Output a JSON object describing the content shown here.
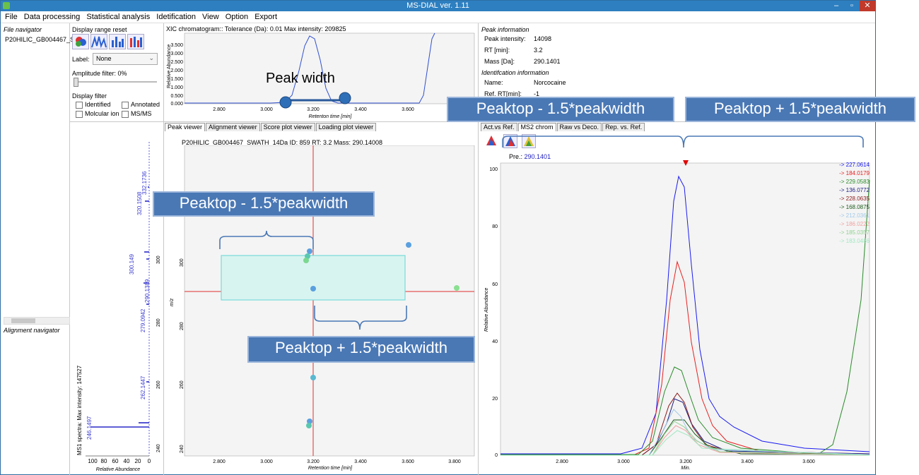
{
  "window": {
    "title": "MS-DIAL ver. 1.11"
  },
  "menu": [
    "File",
    "Data processing",
    "Statistical analysis",
    "Idetification",
    "View",
    "Option",
    "Export"
  ],
  "file_navigator": {
    "title": "File navigator",
    "file": "P20HILIC_GB004467_S",
    "alignment_title": "Alignment navigator"
  },
  "display": {
    "range_reset": "Display range reset",
    "label_caption": "Label:",
    "label_value": "None",
    "amplitude": "Amplitude filter: 0%",
    "filter_title": "Display filter",
    "filters": [
      "Identified",
      "Annotated",
      "Molcular ion",
      "MS/MS"
    ]
  },
  "xic": {
    "title": "XIC chromatogram:: Tolerance (Da): 0.01  Max intensity: 209825",
    "yticks": [
      "3.500",
      "3.000",
      "2.500",
      "2.000",
      "1.500",
      "1.000",
      "0.500",
      "0.000"
    ],
    "ylabel": "Relative Abundance",
    "xticks": [
      "2.800",
      "3.000",
      "3.200",
      "3.400",
      "3.600"
    ],
    "xlabel": "Retenton time [min]"
  },
  "peak_info": {
    "title": "Peak information",
    "rows": [
      {
        "k": "Peak intensity:",
        "v": "14098"
      },
      {
        "k": "RT [min]:",
        "v": "3.2"
      },
      {
        "k": "Mass [Da]:",
        "v": "290.1401"
      }
    ],
    "ident_title": "Identifcation information",
    "ident_rows": [
      {
        "k": "Name:",
        "v": "Norcocaine"
      },
      {
        "k": "Ref. RT[min]:",
        "v": "-1"
      }
    ]
  },
  "viewer_tabs": [
    "Peak viewer",
    "Alignment viewer",
    "Score plot viewer",
    "Loading plot viewer"
  ],
  "ms2_tabs": [
    "Act.vs Ref.",
    "MS2 chrom",
    "Raw vs Deco.",
    "Rep. vs. Ref."
  ],
  "ms1": {
    "peaks": [
      "332.1736",
      "320.1508",
      "300.149",
      "290.1389",
      "279.0942",
      "262.1447",
      "246.1497"
    ],
    "title": "MS1 spectra: Max intensity: 147527",
    "xticks": [
      "100",
      "80",
      "60",
      "40",
      "20",
      "0"
    ],
    "xlabel": "Relative Abundance",
    "mz_ticks": [
      "300",
      "280",
      "260",
      "240"
    ]
  },
  "peak_viewer": {
    "title": "P20HILIC_GB004467_SWATH_14Da  ID: 859  RT: 3.2  Mass: 290.14008",
    "yticks": [
      "300",
      "280",
      "260",
      "240"
    ],
    "ylabel": "m/z",
    "xticks": [
      "2.800",
      "3.000",
      "3.200",
      "3.400",
      "3.600",
      "3.800"
    ],
    "xlabel": "Retention time [min]"
  },
  "ms2": {
    "precursor_label": "Pre.:",
    "precursor_value": "290.1401",
    "yticks": [
      "100",
      "80",
      "60",
      "40",
      "20",
      "0"
    ],
    "ylabel": "Relative Abundance",
    "xticks": [
      "2.800",
      "3.000",
      "3.200",
      "3.400",
      "3.600"
    ],
    "xlabel": "Min.",
    "legend": [
      {
        "label": "-> 227.0614",
        "color": "#1a1af0"
      },
      {
        "label": "-> 184.0179",
        "color": "#e82020"
      },
      {
        "label": "-> 229.0583",
        "color": "#2a8a2a"
      },
      {
        "label": "-> 136.0772",
        "color": "#1a1a80"
      },
      {
        "label": "-> 228.0635",
        "color": "#8a1a1a"
      },
      {
        "label": "-> 168.0875",
        "color": "#1a5a1a"
      },
      {
        "label": "-> 212.0361",
        "color": "#a0c8e8"
      },
      {
        "label": "-> 186.0222",
        "color": "#f0a0a0"
      },
      {
        "label": "-> 185.0357",
        "color": "#90d090"
      },
      {
        "label": "-> 183.0486",
        "color": "#a0e8c0"
      }
    ]
  },
  "annotations": {
    "peak_width": "Peak width",
    "minus": "Peaktop - 1.5*peakwidth",
    "plus": "Peaktop + 1.5*peakwidth"
  }
}
